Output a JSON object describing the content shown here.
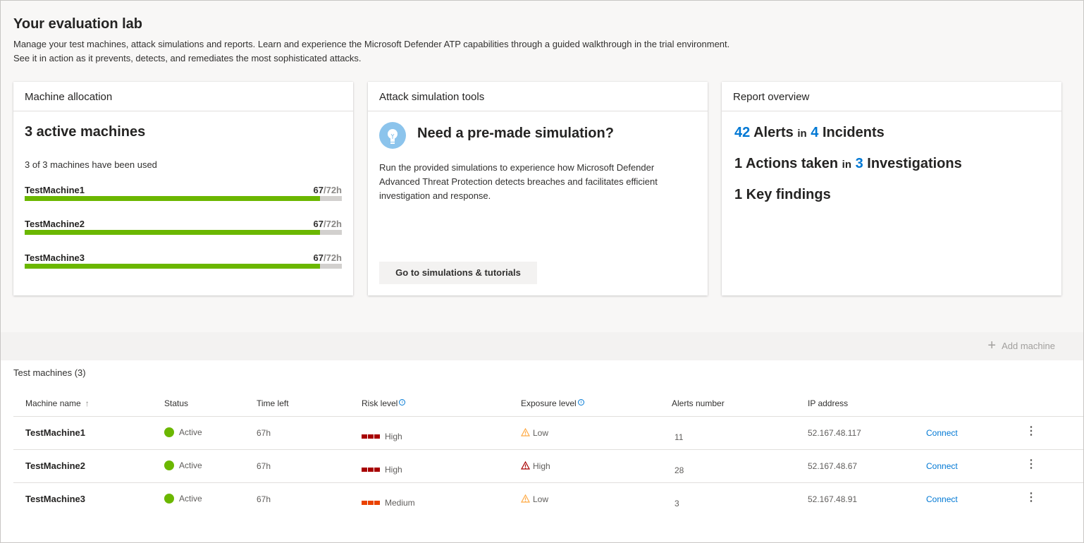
{
  "header": {
    "title": "Your evaluation lab",
    "description_line1": "Manage your test machines, attack simulations and reports. Learn and experience the Microsoft Defender ATP capabilities through a guided walkthrough in the trial environment.",
    "description_line2": "See it in action as it prevents, detects, and remediates the most sophisticated attacks."
  },
  "allocation": {
    "title": "Machine allocation",
    "active": "3 active machines",
    "used_text": "3 of 3 machines have been used",
    "machines": [
      {
        "name": "TestMachine1",
        "used": "67",
        "total": "/72h",
        "fraction": 0.93
      },
      {
        "name": "TestMachine2",
        "used": "67",
        "total": "/72h",
        "fraction": 0.93
      },
      {
        "name": "TestMachine3",
        "used": "67",
        "total": "/72h",
        "fraction": 0.93
      }
    ]
  },
  "simulation": {
    "title": "Attack simulation tools",
    "heading": "Need a pre-made simulation?",
    "description": "Run the provided simulations to experience how Microsoft Defender Advanced Threat Protection detects breaches and facilitates efficient investigation and response.",
    "button": "Go to simulations & tutorials",
    "icon": "lightbulb-icon"
  },
  "report": {
    "title": "Report overview",
    "alerts_num": "42",
    "alerts_label": "Alerts",
    "in": "in",
    "incidents_num": "4",
    "incidents_label": "Incidents",
    "actions_num": "1",
    "actions_label": "Actions taken",
    "investigations_num": "3",
    "investigations_label": "Investigations",
    "findings": "1 Key findings",
    "accent_color": "#0078d4"
  },
  "toolbar": {
    "add_machine": "Add machine"
  },
  "table": {
    "title": "Test machines (3)",
    "columns": {
      "name": "Machine name",
      "status": "Status",
      "time_left": "Time left",
      "risk": "Risk level",
      "exposure": "Exposure level",
      "alerts": "Alerts number",
      "ip": "IP address"
    },
    "rows": [
      {
        "name": "TestMachine1",
        "status": "Active",
        "time_left": "67h",
        "risk": "High",
        "risk_color": "#a80000",
        "exposure": "Low",
        "exposure_color": "#ffaa44",
        "alerts": "11",
        "ip": "52.167.48.117",
        "connect": "Connect"
      },
      {
        "name": "TestMachine2",
        "status": "Active",
        "time_left": "67h",
        "risk": "High",
        "risk_color": "#a80000",
        "exposure": "High",
        "exposure_color": "#a80000",
        "alerts": "28",
        "ip": "52.167.48.67",
        "connect": "Connect"
      },
      {
        "name": "TestMachine3",
        "status": "Active",
        "time_left": "67h",
        "risk": "Medium",
        "risk_color": "#ea4300",
        "exposure": "Low",
        "exposure_color": "#ffaa44",
        "alerts": "3",
        "ip": "52.167.48.91",
        "connect": "Connect"
      }
    ]
  }
}
